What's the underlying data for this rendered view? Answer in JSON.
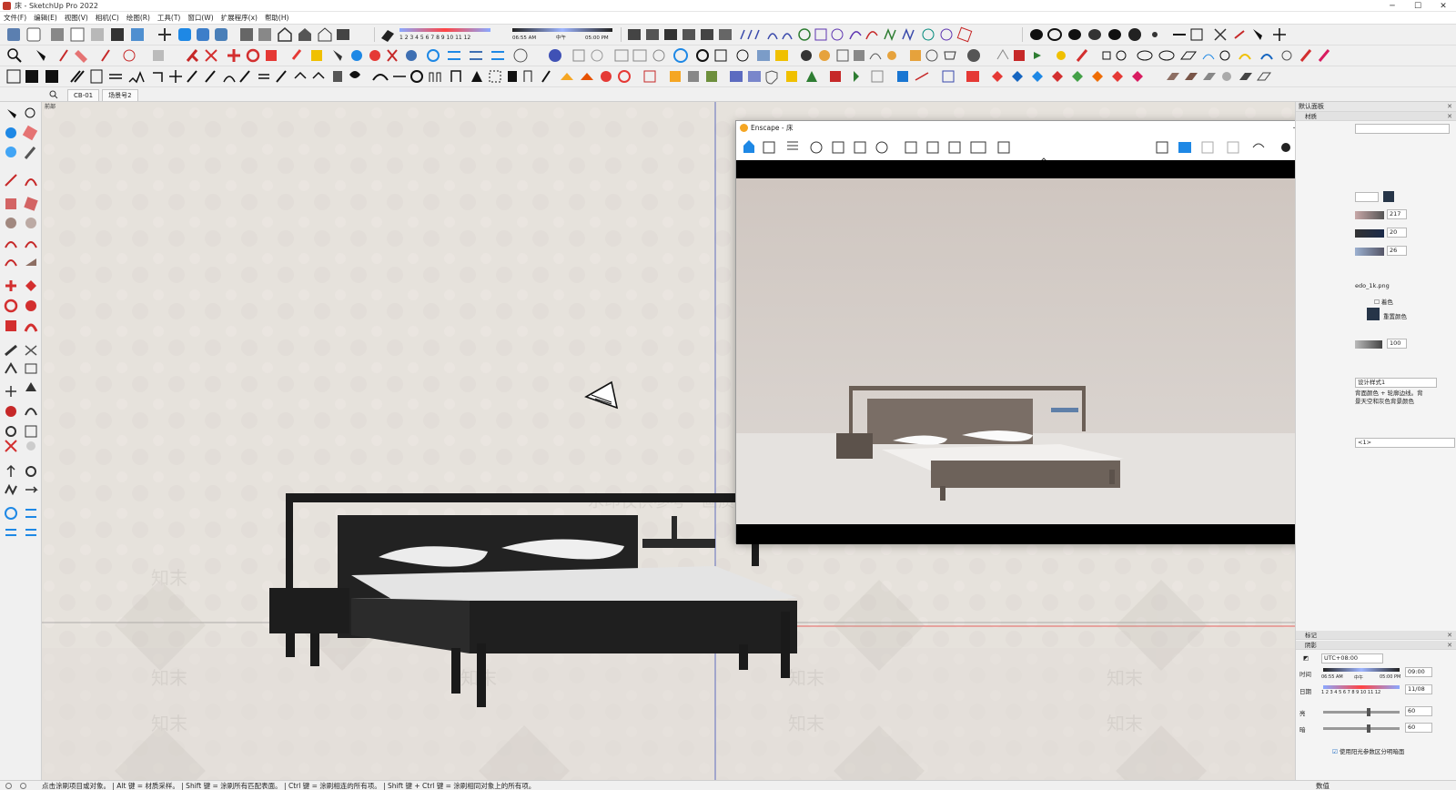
{
  "window": {
    "title": "床 - SketchUp Pro 2022"
  },
  "menu": [
    "文件(F)",
    "编辑(E)",
    "视图(V)",
    "相机(C)",
    "绘图(R)",
    "工具(T)",
    "窗口(W)",
    "扩展程序(x)",
    "帮助(H)"
  ],
  "shadow_toolbar": {
    "time_start": "06:55 AM",
    "time_mid": "中午",
    "time_end": "05:00 PM",
    "months": "1 2 3 4 5 6 7 8 9 10 11 12"
  },
  "scene_tabs": [
    "CB-01",
    "场景号2"
  ],
  "viewport": {
    "label": "前部",
    "watermark_text": "水印仅供参考 · 画质会受到部分影响",
    "watermark_logo": "知末"
  },
  "enscape": {
    "title": "Enscape - 床"
  },
  "right_panel": {
    "tray_title": "默认面板",
    "materials_header": "材质",
    "rgb": [
      "217",
      "20",
      "26"
    ],
    "texture_file": "edo_1k.png",
    "colorize_label": "着色",
    "reset_color_label": "重置颜色",
    "opacity": "100",
    "style_title": "设计样式1",
    "style_desc": "背面颜色 + 轮廓边线。背景天空和灰色背景颜色",
    "layer_select": "<1>",
    "tags_header": "标记",
    "shadows_header": "阴影",
    "timezone": "UTC+08:00",
    "time_label": "时间",
    "date_label": "日期",
    "time_value": "09:00",
    "date_value": "11/08",
    "time_start": "06:55 AM",
    "time_mid": "中午",
    "time_end": "05:00 PM",
    "months": "1 2 3 4 5 6 7 8 9 10 11 12",
    "light_label": "亮",
    "dark_label": "暗",
    "light_value": "60",
    "dark_value": "60",
    "light_level": 0.6,
    "dark_level": 0.6,
    "sun_checkbox_label": "使用阳光参数区分明暗面"
  },
  "status": {
    "message": "点击涂刷项目或对象。 | Alt 键 = 材质采样。 | Shift 键 = 涂刷所有匹配表面。 | Ctrl 键 = 涂刷相连的所有项。 | Shift 键 + Ctrl 键 = 涂刷相同对象上的所有项。",
    "measure_label": "数值"
  },
  "colors": {
    "accent": "#1e88e5",
    "bed_frame": "#1e1e1e",
    "linen": "#e6e6e6",
    "red_tool": "#d32f2f"
  }
}
